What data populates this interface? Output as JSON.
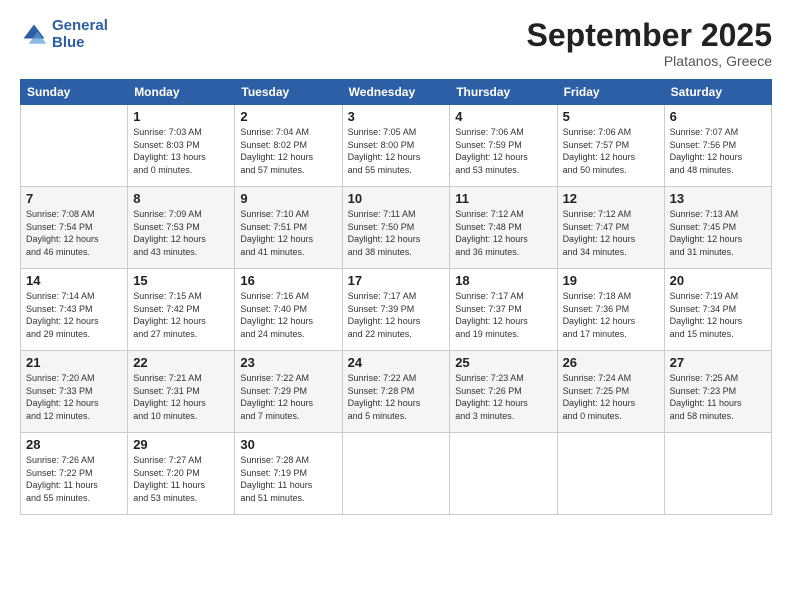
{
  "logo": {
    "text_general": "General",
    "text_blue": "Blue"
  },
  "header": {
    "month": "September 2025",
    "location": "Platanos, Greece"
  },
  "days_of_week": [
    "Sunday",
    "Monday",
    "Tuesday",
    "Wednesday",
    "Thursday",
    "Friday",
    "Saturday"
  ],
  "weeks": [
    [
      {
        "day": "",
        "info": ""
      },
      {
        "day": "1",
        "info": "Sunrise: 7:03 AM\nSunset: 8:03 PM\nDaylight: 13 hours\nand 0 minutes."
      },
      {
        "day": "2",
        "info": "Sunrise: 7:04 AM\nSunset: 8:02 PM\nDaylight: 12 hours\nand 57 minutes."
      },
      {
        "day": "3",
        "info": "Sunrise: 7:05 AM\nSunset: 8:00 PM\nDaylight: 12 hours\nand 55 minutes."
      },
      {
        "day": "4",
        "info": "Sunrise: 7:06 AM\nSunset: 7:59 PM\nDaylight: 12 hours\nand 53 minutes."
      },
      {
        "day": "5",
        "info": "Sunrise: 7:06 AM\nSunset: 7:57 PM\nDaylight: 12 hours\nand 50 minutes."
      },
      {
        "day": "6",
        "info": "Sunrise: 7:07 AM\nSunset: 7:56 PM\nDaylight: 12 hours\nand 48 minutes."
      }
    ],
    [
      {
        "day": "7",
        "info": "Sunrise: 7:08 AM\nSunset: 7:54 PM\nDaylight: 12 hours\nand 46 minutes."
      },
      {
        "day": "8",
        "info": "Sunrise: 7:09 AM\nSunset: 7:53 PM\nDaylight: 12 hours\nand 43 minutes."
      },
      {
        "day": "9",
        "info": "Sunrise: 7:10 AM\nSunset: 7:51 PM\nDaylight: 12 hours\nand 41 minutes."
      },
      {
        "day": "10",
        "info": "Sunrise: 7:11 AM\nSunset: 7:50 PM\nDaylight: 12 hours\nand 38 minutes."
      },
      {
        "day": "11",
        "info": "Sunrise: 7:12 AM\nSunset: 7:48 PM\nDaylight: 12 hours\nand 36 minutes."
      },
      {
        "day": "12",
        "info": "Sunrise: 7:12 AM\nSunset: 7:47 PM\nDaylight: 12 hours\nand 34 minutes."
      },
      {
        "day": "13",
        "info": "Sunrise: 7:13 AM\nSunset: 7:45 PM\nDaylight: 12 hours\nand 31 minutes."
      }
    ],
    [
      {
        "day": "14",
        "info": "Sunrise: 7:14 AM\nSunset: 7:43 PM\nDaylight: 12 hours\nand 29 minutes."
      },
      {
        "day": "15",
        "info": "Sunrise: 7:15 AM\nSunset: 7:42 PM\nDaylight: 12 hours\nand 27 minutes."
      },
      {
        "day": "16",
        "info": "Sunrise: 7:16 AM\nSunset: 7:40 PM\nDaylight: 12 hours\nand 24 minutes."
      },
      {
        "day": "17",
        "info": "Sunrise: 7:17 AM\nSunset: 7:39 PM\nDaylight: 12 hours\nand 22 minutes."
      },
      {
        "day": "18",
        "info": "Sunrise: 7:17 AM\nSunset: 7:37 PM\nDaylight: 12 hours\nand 19 minutes."
      },
      {
        "day": "19",
        "info": "Sunrise: 7:18 AM\nSunset: 7:36 PM\nDaylight: 12 hours\nand 17 minutes."
      },
      {
        "day": "20",
        "info": "Sunrise: 7:19 AM\nSunset: 7:34 PM\nDaylight: 12 hours\nand 15 minutes."
      }
    ],
    [
      {
        "day": "21",
        "info": "Sunrise: 7:20 AM\nSunset: 7:33 PM\nDaylight: 12 hours\nand 12 minutes."
      },
      {
        "day": "22",
        "info": "Sunrise: 7:21 AM\nSunset: 7:31 PM\nDaylight: 12 hours\nand 10 minutes."
      },
      {
        "day": "23",
        "info": "Sunrise: 7:22 AM\nSunset: 7:29 PM\nDaylight: 12 hours\nand 7 minutes."
      },
      {
        "day": "24",
        "info": "Sunrise: 7:22 AM\nSunset: 7:28 PM\nDaylight: 12 hours\nand 5 minutes."
      },
      {
        "day": "25",
        "info": "Sunrise: 7:23 AM\nSunset: 7:26 PM\nDaylight: 12 hours\nand 3 minutes."
      },
      {
        "day": "26",
        "info": "Sunrise: 7:24 AM\nSunset: 7:25 PM\nDaylight: 12 hours\nand 0 minutes."
      },
      {
        "day": "27",
        "info": "Sunrise: 7:25 AM\nSunset: 7:23 PM\nDaylight: 11 hours\nand 58 minutes."
      }
    ],
    [
      {
        "day": "28",
        "info": "Sunrise: 7:26 AM\nSunset: 7:22 PM\nDaylight: 11 hours\nand 55 minutes."
      },
      {
        "day": "29",
        "info": "Sunrise: 7:27 AM\nSunset: 7:20 PM\nDaylight: 11 hours\nand 53 minutes."
      },
      {
        "day": "30",
        "info": "Sunrise: 7:28 AM\nSunset: 7:19 PM\nDaylight: 11 hours\nand 51 minutes."
      },
      {
        "day": "",
        "info": ""
      },
      {
        "day": "",
        "info": ""
      },
      {
        "day": "",
        "info": ""
      },
      {
        "day": "",
        "info": ""
      }
    ]
  ]
}
